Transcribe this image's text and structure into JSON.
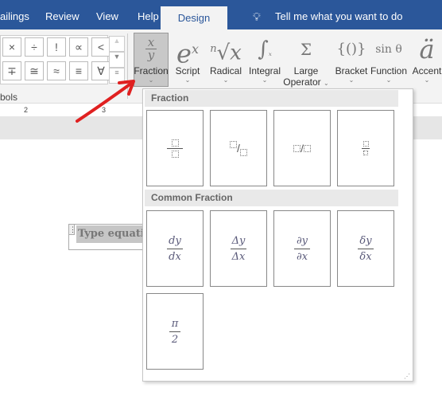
{
  "tabs": {
    "mailings": "ailings",
    "review": "Review",
    "view": "View",
    "help": "Help",
    "design": "Design",
    "tell_me": "Tell me what you want to do"
  },
  "symbols": {
    "row1": [
      "×",
      "÷",
      "!",
      "∝",
      "<"
    ],
    "row2": [
      "∓",
      "≅",
      "≈",
      "≡",
      "∀"
    ],
    "group_label": "bols"
  },
  "structures": [
    {
      "glyph": "x/y",
      "label": "Fraction"
    },
    {
      "glyph": "eˣ",
      "label": "Script"
    },
    {
      "glyph": "ⁿ√x",
      "label": "Radical"
    },
    {
      "glyph": "∫",
      "label": "Integral"
    },
    {
      "glyph": "Σ",
      "label": "Large",
      "label2": "Operator"
    },
    {
      "glyph": "{()}",
      "label": "Bracket"
    },
    {
      "glyph": "sin θ",
      "label": "Function"
    },
    {
      "glyph": "ä",
      "label": "Accent"
    }
  ],
  "ruler": {
    "marks": [
      "2",
      "3"
    ]
  },
  "panel": {
    "section1": "Fraction",
    "fraction_types": [
      "stacked",
      "skewed",
      "linear",
      "small"
    ],
    "section2": "Common Fraction",
    "common": [
      {
        "num": "dy",
        "den": "dx"
      },
      {
        "num": "Δy",
        "den": "Δx"
      },
      {
        "num": "∂y",
        "den": "∂x"
      },
      {
        "num": "δy",
        "den": "δx"
      },
      {
        "num": "π",
        "den": "2"
      }
    ]
  },
  "equation": {
    "placeholder": "Type equation here."
  },
  "colors": {
    "brand": "#2b579a",
    "arrow": "#e02020"
  }
}
